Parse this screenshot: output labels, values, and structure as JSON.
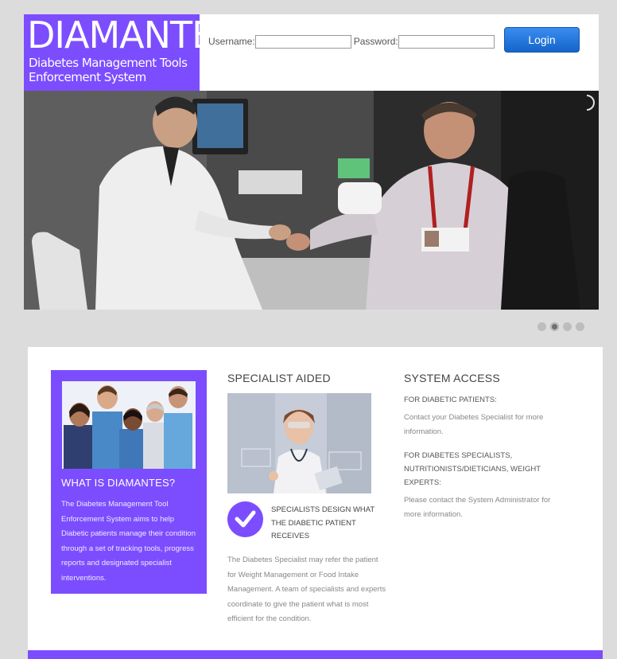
{
  "header": {
    "logo_title": "DIAMANTES",
    "logo_subtitle_line1": "Diabetes Management Tools",
    "logo_subtitle_line2": "Enforcement System",
    "username_label": "Username:",
    "password_label": "Password:",
    "username_value": "",
    "password_value": "",
    "login_label": "Login"
  },
  "carousel": {
    "slide_count": 4,
    "active_index": 1
  },
  "what_is": {
    "title": "WHAT IS DIAMANTES?",
    "text": "The Diabetes Management Tool Enforcement System aims to help Diabetic patients manage their condition through a set of tracking tools, progress reports and designated specialist interventions."
  },
  "specialist": {
    "title": "SPECIALIST AIDED",
    "bullet_title": "SPECIALISTS DESIGN WHAT THE DIABETIC PATIENT RECEIVES",
    "text": "The Diabetes Specialist may refer the patient for Weight Management or Food Intake Management. A team of specialists and experts coordinate to give the patient what is most efficient for the condition."
  },
  "system_access": {
    "title": "SYSTEM ACCESS",
    "patients_heading": "FOR DIABETIC PATIENTS:",
    "patients_text": "Contact your Diabetes Specialist for more information.",
    "specialists_heading": "FOR DIABETES SPECIALISTS, NUTRITIONISTS/DIETICIANS, WEIGHT EXPERTS:",
    "specialists_text": "Please contact the System Administrator for more information."
  },
  "colors": {
    "brand": "#7c4dff",
    "login_button": "#1e6fd9",
    "page_background": "#dcdcdc"
  },
  "icons": {
    "check": "check-circle-icon"
  }
}
